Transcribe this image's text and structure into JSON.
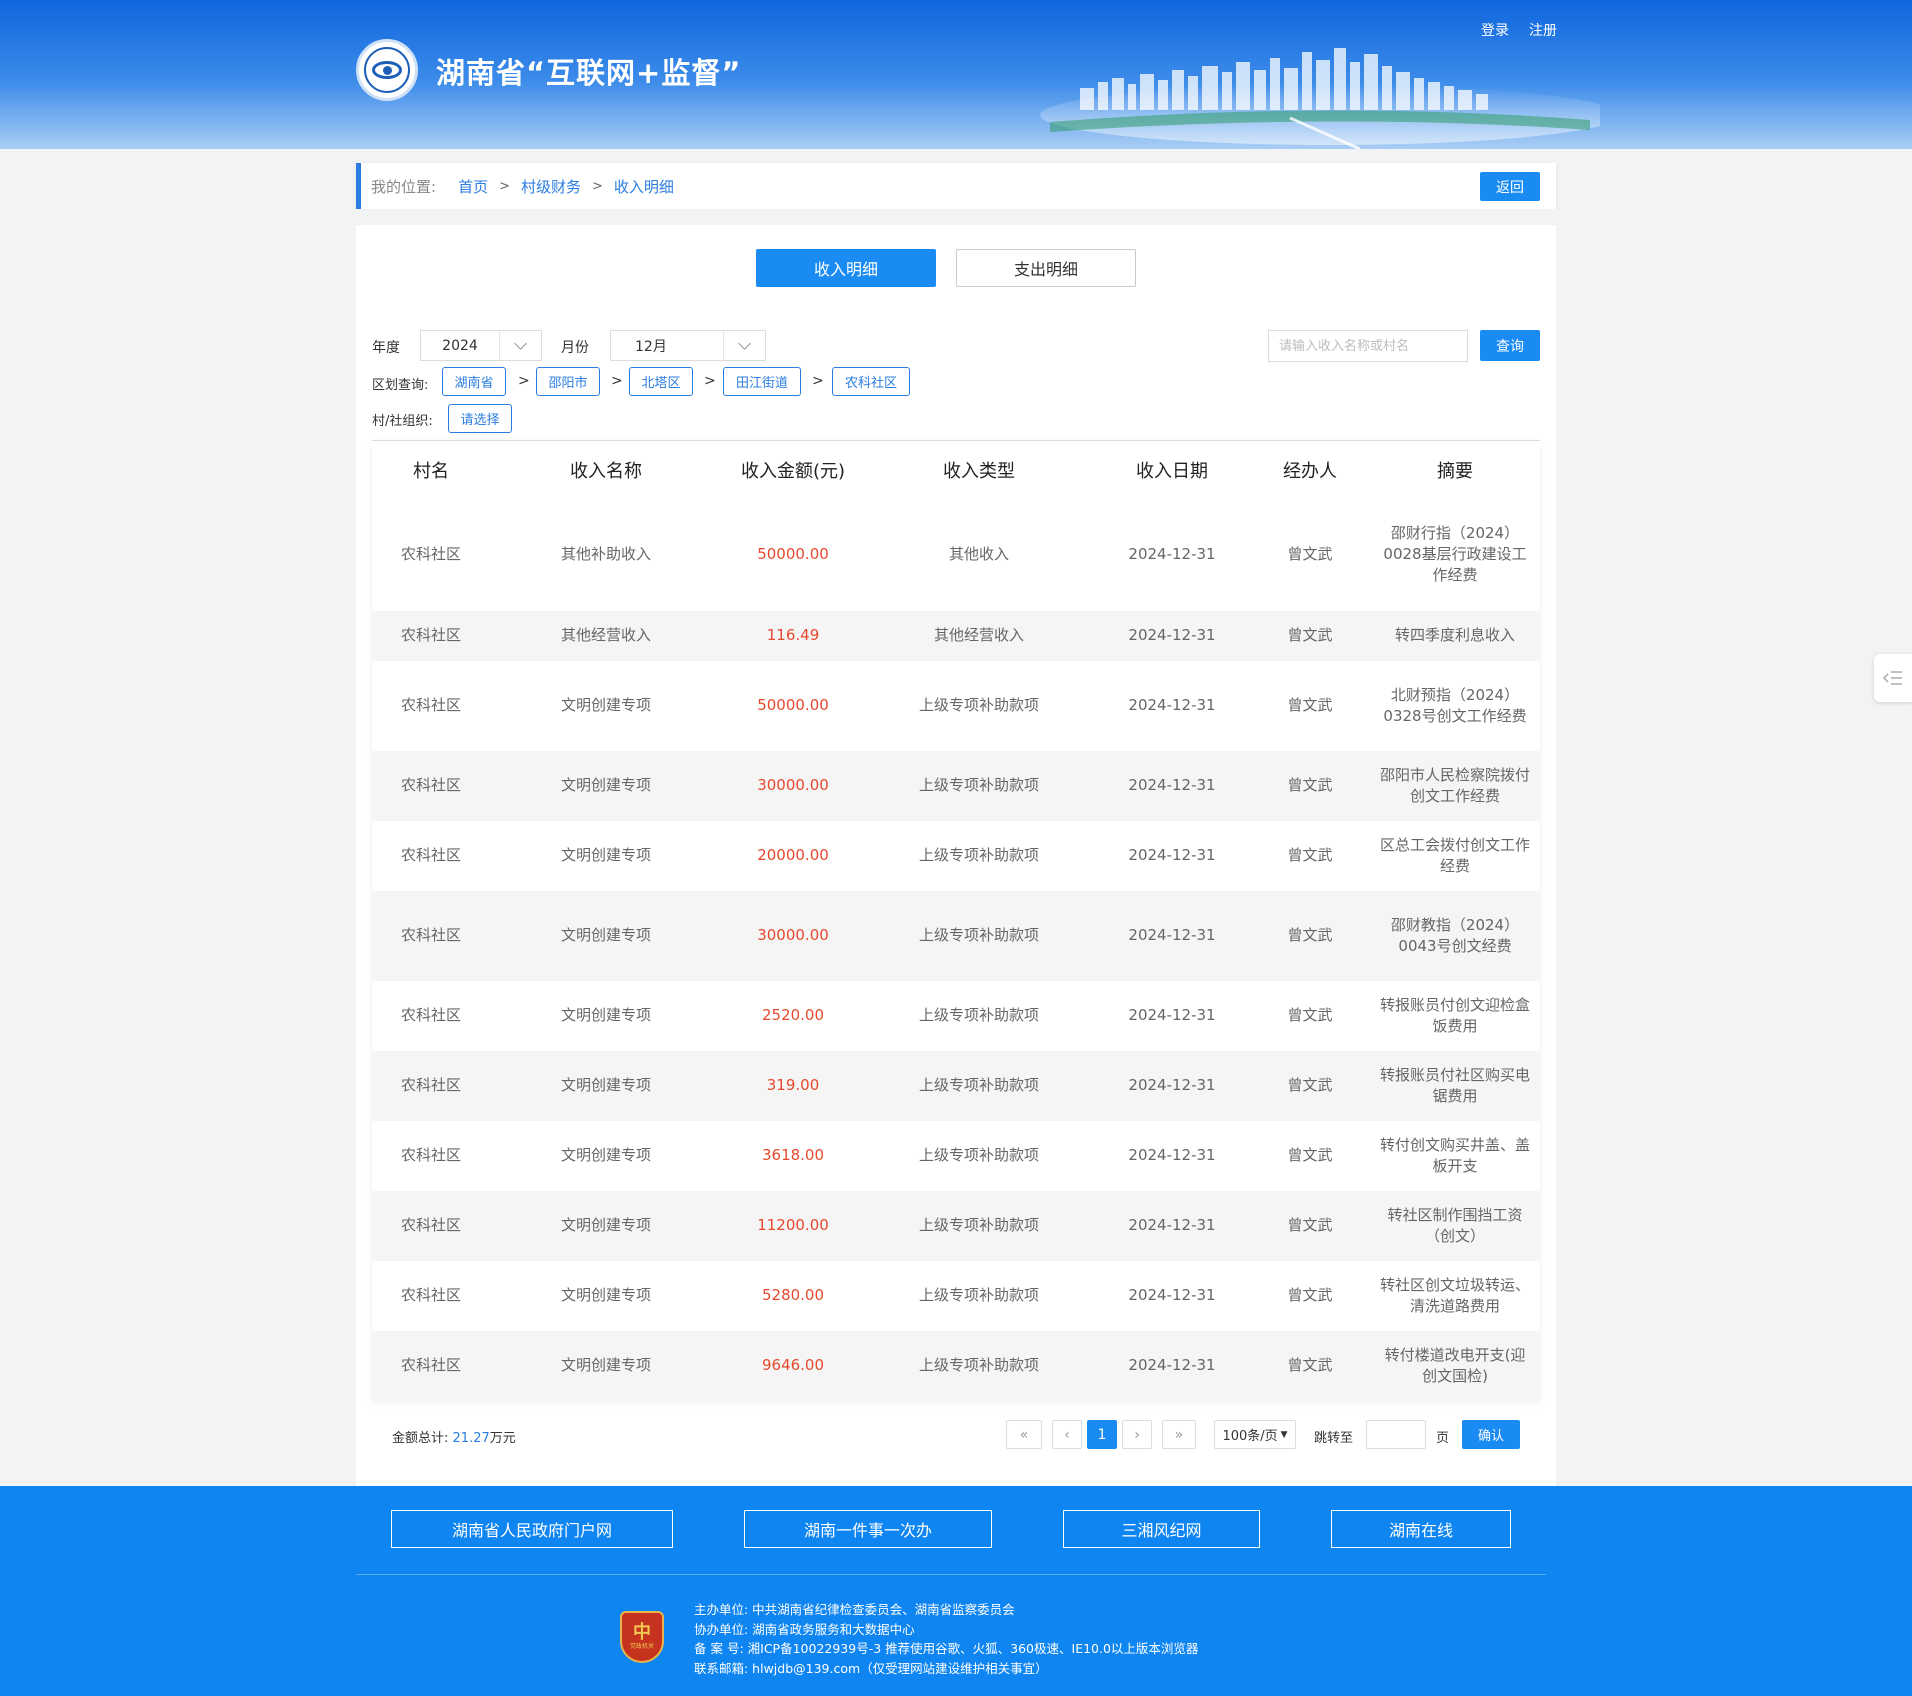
{
  "header": {
    "site_title": "湖南省“互联网+监督”",
    "login": "登录",
    "register": "注册"
  },
  "breadcrumb": {
    "label": "我的位置:",
    "items": [
      "首页",
      "村级财务",
      "收入明细"
    ],
    "separator": ">",
    "back_button": "返回"
  },
  "tabs": {
    "income": "收入明细",
    "expense": "支出明细"
  },
  "filters": {
    "year_label": "年度",
    "year_value": "2024",
    "month_label": "月份",
    "month_value": "12月",
    "search_placeholder": "请输入收入名称或村名",
    "query_button": "查询",
    "region_label": "区划查询:",
    "region_chain": [
      "湖南省",
      "邵阳市",
      "北塔区",
      "田江街道",
      "农科社区"
    ],
    "org_label": "村/社组织:",
    "org_button": "请选择"
  },
  "table": {
    "headers": [
      "村名",
      "收入名称",
      "收入金额(元)",
      "收入类型",
      "收入日期",
      "经办人",
      "摘要"
    ],
    "rows": [
      {
        "village": "农科社区",
        "name": "其他补助收入",
        "amount": "50000.00",
        "type": "其他收入",
        "date": "2024-12-31",
        "handler": "曾文武",
        "summary": "邵财行指（2024）0028基层行政建设工作经费"
      },
      {
        "village": "农科社区",
        "name": "其他经营收入",
        "amount": "116.49",
        "type": "其他经营收入",
        "date": "2024-12-31",
        "handler": "曾文武",
        "summary": "转四季度利息收入"
      },
      {
        "village": "农科社区",
        "name": "文明创建专项",
        "amount": "50000.00",
        "type": "上级专项补助款项",
        "date": "2024-12-31",
        "handler": "曾文武",
        "summary": "北财预指（2024）0328号创文工作经费"
      },
      {
        "village": "农科社区",
        "name": "文明创建专项",
        "amount": "30000.00",
        "type": "上级专项补助款项",
        "date": "2024-12-31",
        "handler": "曾文武",
        "summary": "邵阳市人民检察院拨付创文工作经费"
      },
      {
        "village": "农科社区",
        "name": "文明创建专项",
        "amount": "20000.00",
        "type": "上级专项补助款项",
        "date": "2024-12-31",
        "handler": "曾文武",
        "summary": "区总工会拨付创文工作经费"
      },
      {
        "village": "农科社区",
        "name": "文明创建专项",
        "amount": "30000.00",
        "type": "上级专项补助款项",
        "date": "2024-12-31",
        "handler": "曾文武",
        "summary": "邵财教指（2024）0043号创文经费"
      },
      {
        "village": "农科社区",
        "name": "文明创建专项",
        "amount": "2520.00",
        "type": "上级专项补助款项",
        "date": "2024-12-31",
        "handler": "曾文武",
        "summary": "转报账员付创文迎检盒饭费用"
      },
      {
        "village": "农科社区",
        "name": "文明创建专项",
        "amount": "319.00",
        "type": "上级专项补助款项",
        "date": "2024-12-31",
        "handler": "曾文武",
        "summary": "转报账员付社区购买电锯费用"
      },
      {
        "village": "农科社区",
        "name": "文明创建专项",
        "amount": "3618.00",
        "type": "上级专项补助款项",
        "date": "2024-12-31",
        "handler": "曾文武",
        "summary": "转付创文购买井盖、盖板开支"
      },
      {
        "village": "农科社区",
        "name": "文明创建专项",
        "amount": "11200.00",
        "type": "上级专项补助款项",
        "date": "2024-12-31",
        "handler": "曾文武",
        "summary": "转社区制作围挡工资（创文）"
      },
      {
        "village": "农科社区",
        "name": "文明创建专项",
        "amount": "5280.00",
        "type": "上级专项补助款项",
        "date": "2024-12-31",
        "handler": "曾文武",
        "summary": "转社区创文垃圾转运、清洗道路费用"
      },
      {
        "village": "农科社区",
        "name": "文明创建专项",
        "amount": "9646.00",
        "type": "上级专项补助款项",
        "date": "2024-12-31",
        "handler": "曾文武",
        "summary": "转付楼道改电开支(迎创文国检)"
      }
    ]
  },
  "summary": {
    "label": "金额总计:",
    "value": "21.27",
    "unit": "万元"
  },
  "pagination": {
    "first": "«",
    "prev": "‹",
    "current": "1",
    "next": "›",
    "last": "»",
    "page_size": "100条/页",
    "jump_label": "跳转至",
    "page_unit": "页",
    "confirm": "确认"
  },
  "footer": {
    "links": [
      "湖南省人民政府门户网",
      "湖南一件事一次办",
      "三湘风纪网",
      "湖南在线"
    ],
    "badge_char": "中",
    "badge_text": "党政机关",
    "info": [
      "主办单位:  中共湖南省纪律检查委员会、湖南省监察委员会",
      "协办单位:  湖南省政务服务和大数据中心",
      "备  案  号:  湘ICP备10022939号-3   推荐使用谷歌、火狐、360极速、IE10.0以上版本浏览器",
      "联系邮箱:  hlwjdb@139.com（仅受理网站建设维护相关事宜）"
    ]
  },
  "icons": {
    "logo": "eye-emblem-icon",
    "dropdown": "chevron-down-icon",
    "side": "collapse-menu-icon",
    "badge": "government-badge-icon"
  },
  "colors": {
    "primary": "#1a8bf2",
    "amount": "#e8492d",
    "footer": "#0f85f2"
  }
}
